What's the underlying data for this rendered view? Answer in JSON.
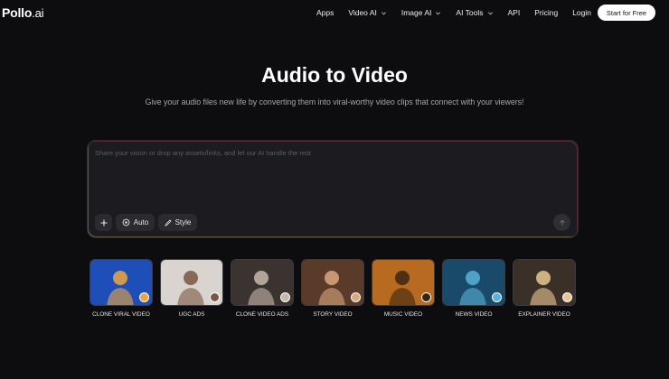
{
  "header": {
    "logo_main": "Pollo",
    "logo_suffix": ".ai",
    "nav": [
      {
        "label": "Apps",
        "dropdown": false
      },
      {
        "label": "Video AI",
        "dropdown": true
      },
      {
        "label": "Image AI",
        "dropdown": true
      },
      {
        "label": "AI Tools",
        "dropdown": true
      },
      {
        "label": "API",
        "dropdown": false
      },
      {
        "label": "Pricing",
        "dropdown": false
      },
      {
        "label": "Login",
        "dropdown": false
      }
    ],
    "cta_label": "Start for Free"
  },
  "hero": {
    "title": "Audio to Video",
    "subtitle": "Give your audio files new life by converting them into viral-worthy video clips that connect with your viewers!"
  },
  "prompt": {
    "placeholder": "Share your vision or drop any assets/links, and let our AI handle the rest",
    "auto_label": "Auto",
    "style_label": "Style"
  },
  "cards": [
    {
      "label": "CLONE VIRAL VIDEO",
      "bg": "#1e4fb8",
      "accent": "#f0a640"
    },
    {
      "label": "UGC ADS",
      "bg": "#d9d4cf",
      "accent": "#7a5640"
    },
    {
      "label": "CLONE VIDEO ADS",
      "bg": "#3a3330",
      "accent": "#c8b8a8"
    },
    {
      "label": "STORY VIDEO",
      "bg": "#5a3a28",
      "accent": "#d8a880"
    },
    {
      "label": "MUSIC VIDEO",
      "bg": "#b86a20",
      "accent": "#3a2410"
    },
    {
      "label": "NEWS VIDEO",
      "bg": "#1a4a6a",
      "accent": "#5ab0d8"
    },
    {
      "label": "EXPLAINER VIDEO",
      "bg": "#3a3028",
      "accent": "#e8c890"
    }
  ]
}
